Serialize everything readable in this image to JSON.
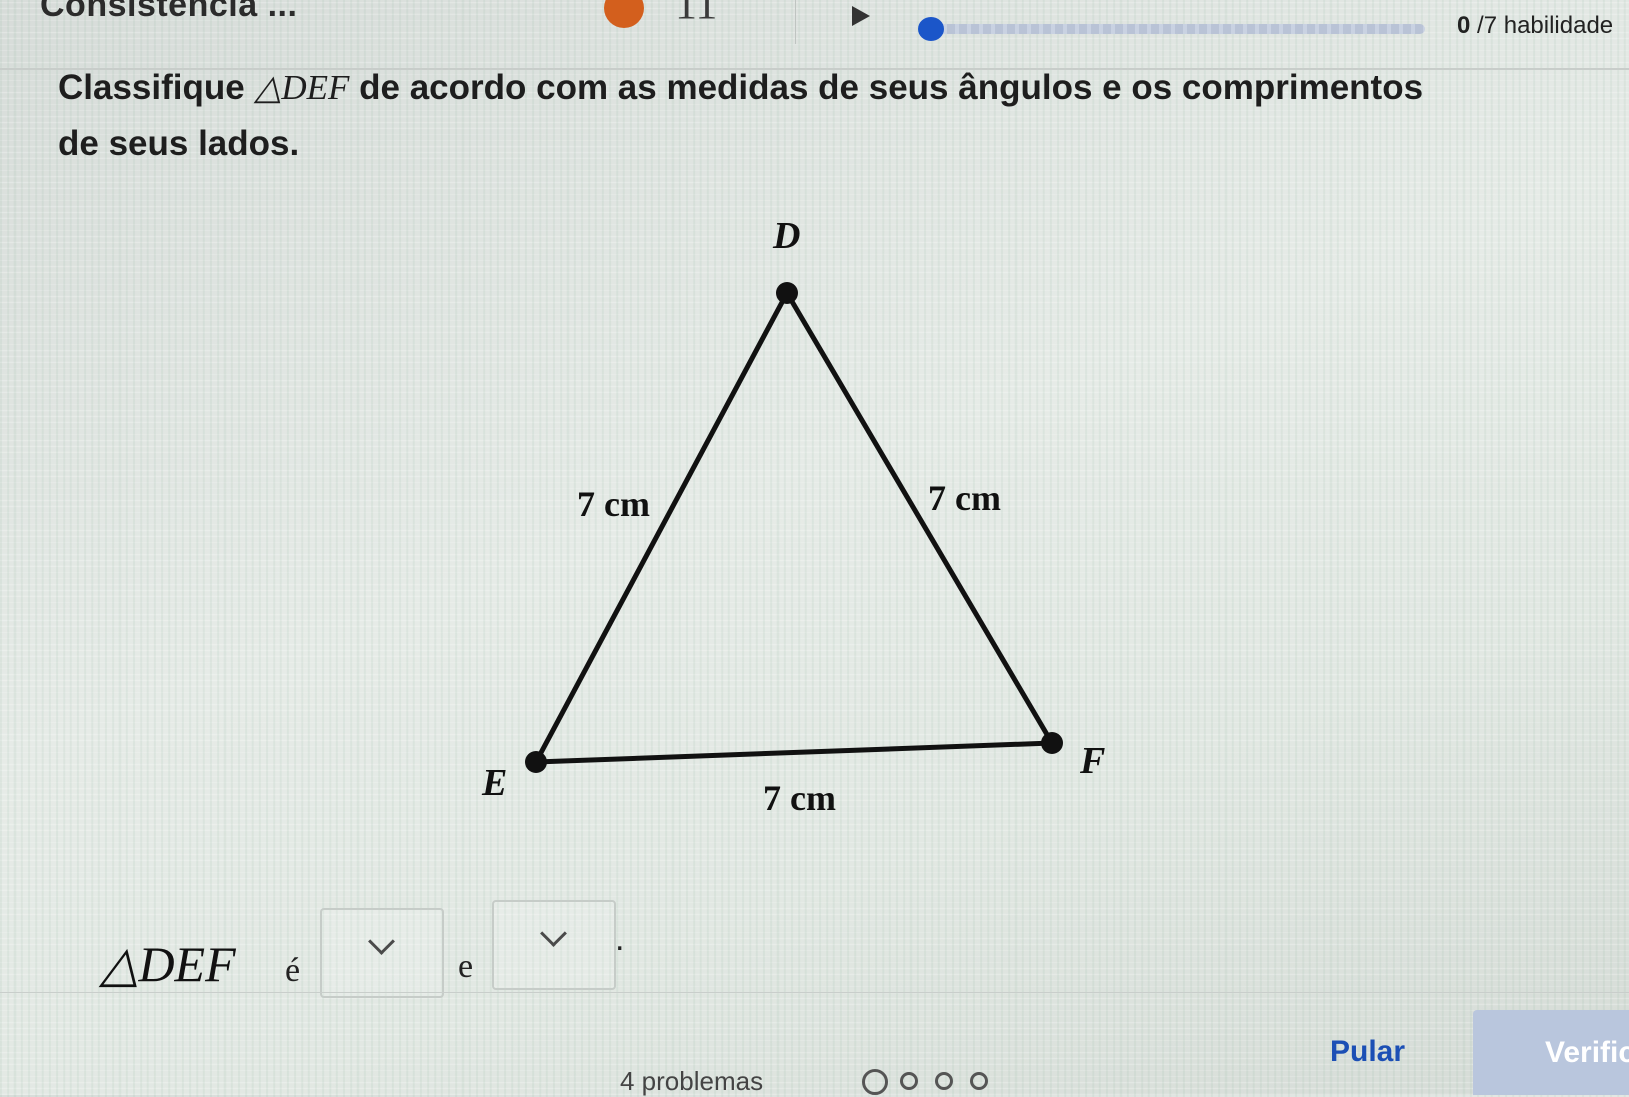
{
  "header": {
    "title": "Consistência ...",
    "streak_count": "11",
    "progress_fraction": 0.0,
    "skills_score": "0",
    "skills_label": "/7 habilidade"
  },
  "question": {
    "text_before": "Classifique ",
    "math": "△DEF",
    "text_after": " de acordo com as medidas de seus ângulos e os comprimentos de seus lados."
  },
  "figure": {
    "vertices": {
      "D": "D",
      "E": "E",
      "F": "F"
    },
    "side_labels": {
      "DE": "7 cm",
      "DF": "7 cm",
      "EF": "7 cm"
    }
  },
  "answer": {
    "math": "△DEF",
    "word_is": "é",
    "word_and": "e",
    "dropdown_1_value": "",
    "dropdown_2_value": "",
    "period": "."
  },
  "footer": {
    "problems_text": "4 problemas",
    "skip_label": "Pular",
    "check_label": "Verificar"
  },
  "colors": {
    "accent": "#1b56c9",
    "streak": "#d35f1d",
    "check_disabled": "#b9c6dd"
  }
}
